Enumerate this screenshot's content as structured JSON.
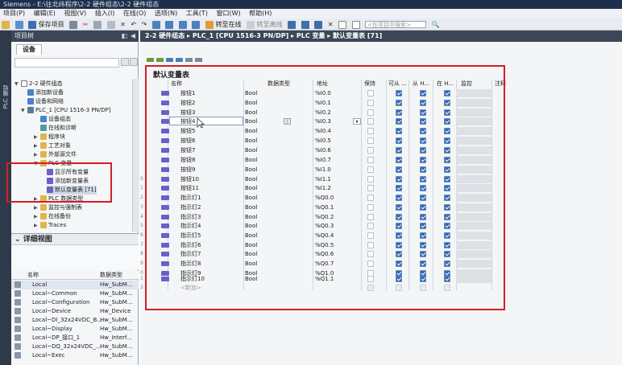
{
  "window": {
    "title": "Siemens - E:\\往北纬程序\\2-2 硬件组态\\2-2 硬件组态"
  },
  "menu": [
    "项目(P)",
    "编辑(E)",
    "视图(V)",
    "插入(I)",
    "在线(O)",
    "选项(N)",
    "工具(T)",
    "窗口(W)",
    "帮助(H)"
  ],
  "toolbar": {
    "save": "保存项目",
    "go_online": "转至在线",
    "go_offline": "转至离线",
    "search_placeholder": "<在项目中搜索>"
  },
  "sidebar_tab": "PLC 编程",
  "project_tree": {
    "header": "项目树",
    "devices_tab": "设备",
    "items": [
      {
        "label": "2-2 硬件组态",
        "indent": 0,
        "expand": "▼"
      },
      {
        "label": "添加新设备",
        "indent": 1,
        "expand": ""
      },
      {
        "label": "设备和网络",
        "indent": 1,
        "expand": ""
      },
      {
        "label": "PLC_1 [CPU 1516-3 PN/DP]",
        "indent": 1,
        "expand": "▼"
      },
      {
        "label": "设备组态",
        "indent": 2,
        "expand": ""
      },
      {
        "label": "在线和诊断",
        "indent": 2,
        "expand": ""
      },
      {
        "label": "程序块",
        "indent": 2,
        "expand": "▶"
      },
      {
        "label": "工艺对象",
        "indent": 2,
        "expand": "▶"
      },
      {
        "label": "外部源文件",
        "indent": 2,
        "expand": "▶"
      },
      {
        "label": "PLC 变量",
        "indent": 2,
        "expand": "▼"
      },
      {
        "label": "显示所有变量",
        "indent": 3,
        "expand": ""
      },
      {
        "label": "添加新变量表",
        "indent": 3,
        "expand": ""
      },
      {
        "label": "默认变量表 [71]",
        "indent": 3,
        "expand": ""
      },
      {
        "label": "PLC 数据类型",
        "indent": 2,
        "expand": "▶"
      },
      {
        "label": "监控与强制表",
        "indent": 2,
        "expand": "▶"
      },
      {
        "label": "在线备份",
        "indent": 2,
        "expand": "▶"
      },
      {
        "label": "Traces",
        "indent": 2,
        "expand": "▶"
      }
    ]
  },
  "detail_view": {
    "header": "详细视图",
    "col_name": "名称",
    "col_type": "数据类型",
    "rows": [
      {
        "name": "Local",
        "type": "Hw_SubM..."
      },
      {
        "name": "Local~Common",
        "type": "Hw_SubM..."
      },
      {
        "name": "Local~Configuration",
        "type": "Hw_SubM..."
      },
      {
        "name": "Local~Device",
        "type": "Hw_Device"
      },
      {
        "name": "Local~DI_32x24VDC_B...",
        "type": "Hw_SubM..."
      },
      {
        "name": "Local~Display",
        "type": "Hw_SubM..."
      },
      {
        "name": "Local~DP_接口_1",
        "type": "Hw_Interf..."
      },
      {
        "name": "Local~DQ_32x24VDC_...",
        "type": "Hw_SubM..."
      },
      {
        "name": "Local~Exec",
        "type": "Hw_SubM..."
      }
    ]
  },
  "breadcrumb": [
    "2-2 硬件组态",
    "PLC_1 [CPU 1516-3 PN/DP]",
    "PLC 变量",
    "默认变量表 [71]"
  ],
  "table": {
    "title": "默认变量表",
    "columns": {
      "name": "名称",
      "type": "数据类型",
      "address": "地址",
      "retain": "保持",
      "access": "可从 ...",
      "write": "从 H...",
      "visible": "在 H...",
      "monitor": "监控",
      "comment": "注释"
    },
    "rows": [
      {
        "num": "",
        "name": "按钮1",
        "type": "Bool",
        "address": "%I0.0"
      },
      {
        "num": "",
        "name": "按钮2",
        "type": "Bool",
        "address": "%I0.1"
      },
      {
        "num": "",
        "name": "按钮3",
        "type": "Bool",
        "address": "%I0.2"
      },
      {
        "num": "",
        "name": "按钮4",
        "type": "Bool",
        "address": "%I0.3"
      },
      {
        "num": "",
        "name": "按钮5",
        "type": "Bool",
        "address": "%I0.4"
      },
      {
        "num": "",
        "name": "按钮6",
        "type": "Bool",
        "address": "%I0.5"
      },
      {
        "num": "",
        "name": "按钮7",
        "type": "Bool",
        "address": "%I0.6"
      },
      {
        "num": "",
        "name": "按钮8",
        "type": "Bool",
        "address": "%I0.7"
      },
      {
        "num": "",
        "name": "按钮9",
        "type": "Bool",
        "address": "%I1.0"
      },
      {
        "num": "0",
        "name": "按钮10",
        "type": "Bool",
        "address": "%I1.1"
      },
      {
        "num": "1",
        "name": "按钮11",
        "type": "Bool",
        "address": "%I1.2"
      },
      {
        "num": "2",
        "name": "指示灯1",
        "type": "Bool",
        "address": "%Q0.0"
      },
      {
        "num": "3",
        "name": "指示灯2",
        "type": "Bool",
        "address": "%Q0.1"
      },
      {
        "num": "4",
        "name": "指示灯3",
        "type": "Bool",
        "address": "%Q0.2"
      },
      {
        "num": "5",
        "name": "指示灯4",
        "type": "Bool",
        "address": "%Q0.3"
      },
      {
        "num": "6",
        "name": "指示灯5",
        "type": "Bool",
        "address": "%Q0.4"
      },
      {
        "num": "7",
        "name": "指示灯6",
        "type": "Bool",
        "address": "%Q0.5"
      },
      {
        "num": "8",
        "name": "指示灯7",
        "type": "Bool",
        "address": "%Q0.6"
      },
      {
        "num": "9",
        "name": "指示灯8",
        "type": "Bool",
        "address": "%Q0.7"
      },
      {
        "num": "0",
        "name": "指示灯9",
        "type": "Bool",
        "address": "%Q1.0"
      },
      {
        "num": "1",
        "name": "指示灯10",
        "type": "Bool",
        "address": "%Q1.1"
      }
    ],
    "add_new": "<新加>",
    "add_num": "2"
  }
}
